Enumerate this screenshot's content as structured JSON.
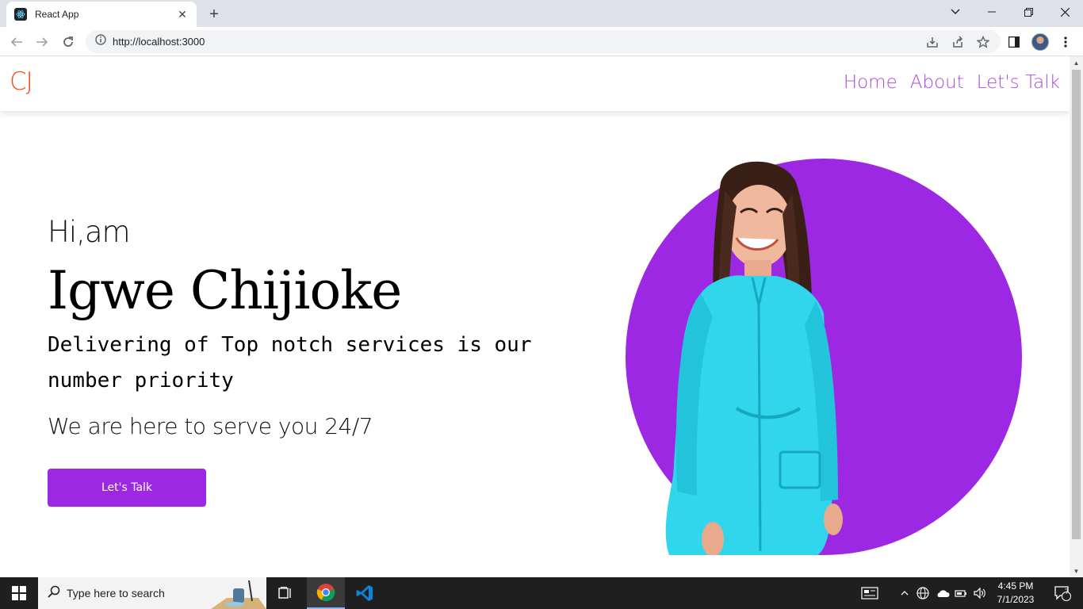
{
  "browser": {
    "tab_title": "React App",
    "url": "http://localhost:3000",
    "new_tab_symbol": "+"
  },
  "site": {
    "logo": "CJ",
    "nav": [
      "Home",
      "About",
      "Let's Talk"
    ],
    "greeting": "Hi,am",
    "name": "Igwe Chijioke",
    "tagline": "Delivering of Top notch services is our number priority",
    "subline": "We are here to serve you 24/7",
    "cta_label": "Let's Talk",
    "colors": {
      "accent": "#9d28e3",
      "nav_link": "#a84bd8",
      "logo": "#f4511e",
      "circle": "#9d28e3",
      "dress": "#2fd6ec"
    }
  },
  "taskbar": {
    "search_placeholder": "Type here to search",
    "time": "4:45 PM",
    "date": "7/1/2023",
    "notification_count": "7",
    "pinned": [
      "task-view-icon",
      "chrome-icon",
      "vscode-icon"
    ]
  }
}
